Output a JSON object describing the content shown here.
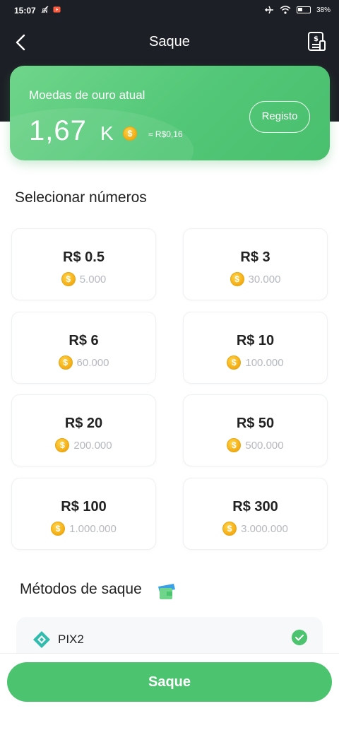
{
  "status_bar": {
    "time": "15:07",
    "battery": "38",
    "battery_level_pct": 38
  },
  "header": {
    "title": "Saque"
  },
  "balance": {
    "label": "Moedas de ouro atual",
    "value": "1,67",
    "unit": "K",
    "approx": "≈ R$0,16",
    "registo_label": "Registo"
  },
  "select": {
    "title": "Selecionar números",
    "options": [
      {
        "amount": "R$ 0.5",
        "coins": "5.000"
      },
      {
        "amount": "R$ 3",
        "coins": "30.000"
      },
      {
        "amount": "R$ 6",
        "coins": "60.000"
      },
      {
        "amount": "R$ 10",
        "coins": "100.000"
      },
      {
        "amount": "R$ 20",
        "coins": "200.000"
      },
      {
        "amount": "R$ 50",
        "coins": "500.000"
      },
      {
        "amount": "R$ 100",
        "coins": "1.000.000"
      },
      {
        "amount": "R$ 300",
        "coins": "3.000.000"
      }
    ]
  },
  "methods": {
    "title": "Métodos de saque",
    "items": [
      {
        "label": "PIX2",
        "selected": true
      }
    ]
  },
  "footer": {
    "button_label": "Saque"
  },
  "colors": {
    "accent": "#4cc46f",
    "dark_header": "#1d1f26",
    "coin": "#f5b21a",
    "pix": "#32bcad"
  },
  "icons": [
    "back-arrow-icon",
    "document-dollar-icon",
    "coin-icon",
    "wallet-icon",
    "pix-icon",
    "check-icon"
  ]
}
